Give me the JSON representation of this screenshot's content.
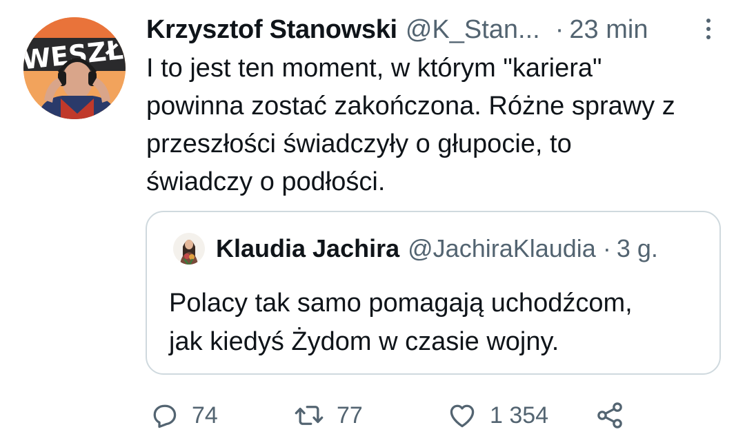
{
  "author": {
    "display_name": "Krzysztof Stanowski",
    "handle": "@K_Stan...",
    "separator": "·",
    "time": "23 min",
    "avatar_text": "WESZŁO"
  },
  "tweet": {
    "lines": [
      "I to jest ten moment, w którym \"kariera\"",
      "powinna zostać zakończona. Różne sprawy z",
      "przeszłości świadczyły o głupocie, to",
      "świadczy o podłości."
    ]
  },
  "quote": {
    "display_name": "Klaudia Jachira",
    "handle": "@JachiraKlaudia",
    "separator": "·",
    "time": "3 g.",
    "lines": [
      "Polacy tak samo pomagają uchodźcom,",
      "jak kiedyś Żydom w czasie wojny."
    ]
  },
  "actions": {
    "replies": "74",
    "retweets": "77",
    "likes": "1 354",
    "icons": {
      "reply": "reply-icon",
      "retweet": "retweet-icon",
      "like": "heart-icon",
      "share": "share-icon",
      "more": "more-icon"
    }
  },
  "colors": {
    "text": "#0f1419",
    "secondary": "#536471",
    "border": "#cfd9de"
  }
}
